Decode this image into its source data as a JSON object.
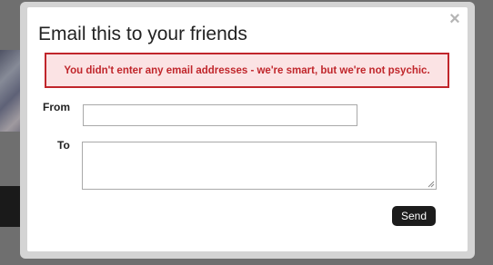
{
  "dialog": {
    "title": "Email this to your friends",
    "close_symbol": "×",
    "error_message": "You didn't enter any email addresses - we're smart, but we're not psychic.",
    "from_label": "From",
    "from_value": "",
    "to_label": "To",
    "to_value": "",
    "send_label": "Send"
  },
  "icons": {
    "close": "close-icon",
    "resize": "resize-grip-icon"
  },
  "colors": {
    "error_text": "#c0262b",
    "error_background": "#fbe3e4",
    "send_button": "#1c1c1c",
    "backdrop": "#6f6f6f"
  }
}
